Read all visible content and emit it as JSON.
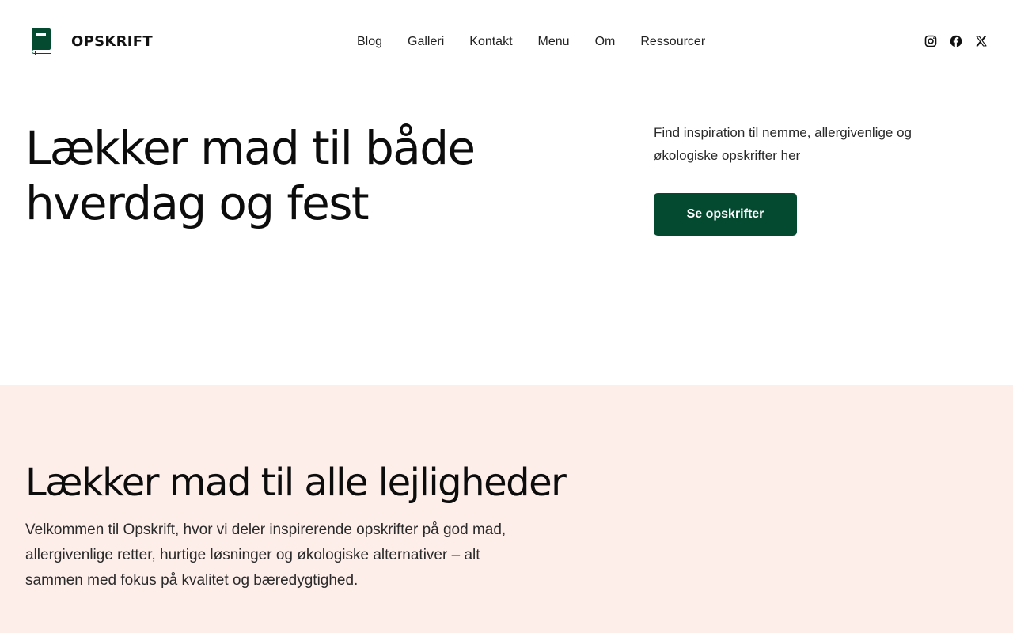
{
  "brand": {
    "name": "OPSKRIFT",
    "logo_icon": "book-icon",
    "logo_color": "#044a31"
  },
  "nav": {
    "items": [
      {
        "label": "Blog"
      },
      {
        "label": "Galleri"
      },
      {
        "label": "Kontakt"
      },
      {
        "label": "Menu"
      },
      {
        "label": "Om"
      },
      {
        "label": "Ressourcer"
      }
    ]
  },
  "social": {
    "items": [
      {
        "icon": "instagram-icon"
      },
      {
        "icon": "facebook-icon"
      },
      {
        "icon": "x-icon"
      }
    ]
  },
  "hero": {
    "title": "Lækker mad til både hverdag og fest",
    "subtitle": "Find inspiration til nemme, allergivenlige og økologiske opskrifter her",
    "cta_label": "Se opskrifter",
    "cta_color": "#044a31"
  },
  "intro": {
    "title": "Lækker mad til alle lejligheder",
    "text": "Velkommen til Opskrift, hvor vi deler inspirerende opskrifter på god mad, allergivenlige retter, hurtige løsninger og økologiske alternativer – alt sammen med fokus på kvalitet og bæredygtighed.",
    "background_color": "#fdeeea"
  }
}
